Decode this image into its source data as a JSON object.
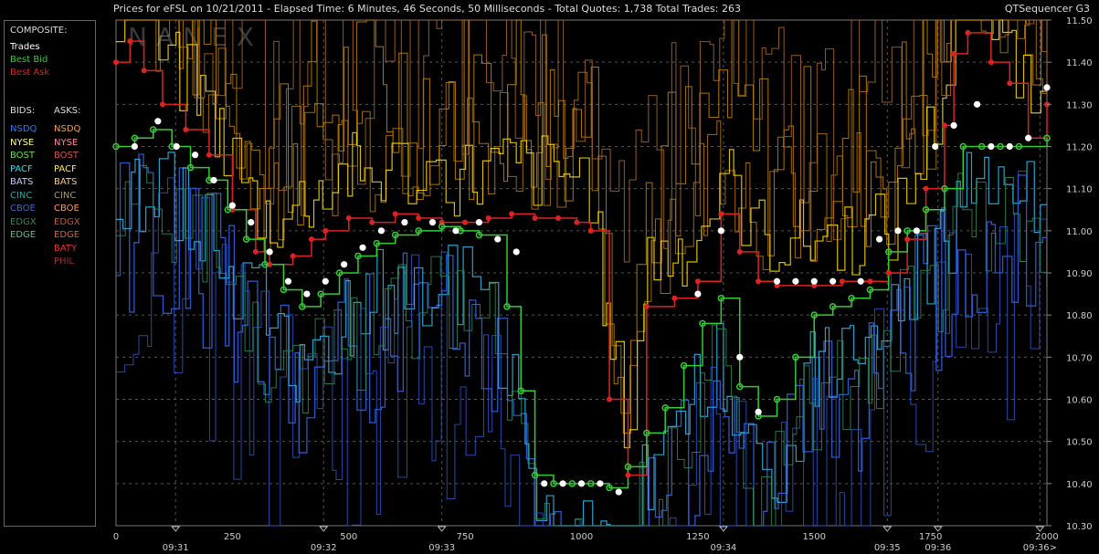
{
  "header": {
    "title": "Prices for  eFSL  on  10/21/2011  -  Elapsed Time: 6 Minutes, 46 Seconds, 50 Milliseconds  -  Total Quotes: 1,738  Total Trades: 263",
    "app_name": "QTSequencer G3"
  },
  "watermark": "NANEX",
  "legend": {
    "composite_label": "COMPOSITE:",
    "composite": [
      {
        "label": "Trades",
        "color": "#ffffff"
      },
      {
        "label": "Best Bid",
        "color": "#33cc33"
      },
      {
        "label": "Best Ask",
        "color": "#dd2222"
      }
    ],
    "bids_label": "BIDS:",
    "asks_label": "ASKS:",
    "bids": [
      {
        "label": "NSDQ",
        "color": "#3377ff"
      },
      {
        "label": "NYSE",
        "color": "#ffff88"
      },
      {
        "label": "BOST",
        "color": "#66dd55"
      },
      {
        "label": "PACF",
        "color": "#22ddee"
      },
      {
        "label": "BATS",
        "color": "#ccccff"
      },
      {
        "label": "CINC",
        "color": "#2aa6a6"
      },
      {
        "label": "CBOE",
        "color": "#4466cc"
      },
      {
        "label": "EDGX",
        "color": "#2e8b57"
      },
      {
        "label": "EDGE",
        "color": "#66bb88"
      }
    ],
    "asks": [
      {
        "label": "NSDQ",
        "color": "#ff9944"
      },
      {
        "label": "NYSE",
        "color": "#ff8899"
      },
      {
        "label": "BOST",
        "color": "#cc5555"
      },
      {
        "label": "PACF",
        "color": "#ffee44"
      },
      {
        "label": "BATS",
        "color": "#ffcc88"
      },
      {
        "label": "CINC",
        "color": "#aa9966"
      },
      {
        "label": "CBOE",
        "color": "#ff9955"
      },
      {
        "label": "EDGX",
        "color": "#cc5533"
      },
      {
        "label": "EDGE",
        "color": "#cc6633"
      },
      {
        "label": "BATY",
        "color": "#dd3333"
      },
      {
        "label": "PHIL",
        "color": "#993333"
      }
    ]
  },
  "colors": {
    "background": "#000000",
    "grid": "#555555",
    "trade": "#ffffff",
    "best_bid": "#33cc33",
    "best_ask": "#dd2222",
    "ask_yellow": "#ffdd00",
    "ask_orange": "#cc8800",
    "bid_blue": "#3366ee",
    "bid_cyan": "#33bbee"
  },
  "chart_data": {
    "type": "line",
    "x_axis": {
      "range": [
        0,
        2000
      ],
      "ticks": [
        0,
        250,
        500,
        750,
        1000,
        1250,
        1500,
        1750,
        2000
      ],
      "time_labels": [
        {
          "x": 128,
          "label": "09:31"
        },
        {
          "x": 446,
          "label": "09:32"
        },
        {
          "x": 700,
          "label": "09:33"
        },
        {
          "x": 1305,
          "label": "09:34"
        },
        {
          "x": 1657,
          "label": "09:35"
        },
        {
          "x": 1766,
          "label": "09:36"
        },
        {
          "x": 1985,
          "label": "09:36>"
        }
      ]
    },
    "y_axis": {
      "range": [
        10.3,
        11.5
      ],
      "ticks": [
        "10.30",
        "10.40",
        "10.50",
        "10.60",
        "10.70",
        "10.80",
        "10.90",
        "11.00",
        "11.10",
        "11.20",
        "11.30",
        "11.40",
        "11.50"
      ]
    },
    "grid": true,
    "series": [
      {
        "name": "Best Ask",
        "values": [
          [
            0,
            11.4
          ],
          [
            30,
            11.45
          ],
          [
            60,
            11.38
          ],
          [
            100,
            11.3
          ],
          [
            150,
            11.24
          ],
          [
            200,
            11.18
          ],
          [
            250,
            11.05
          ],
          [
            300,
            10.95
          ],
          [
            330,
            10.92
          ],
          [
            380,
            10.94
          ],
          [
            420,
            10.98
          ],
          [
            450,
            11.0
          ],
          [
            500,
            11.03
          ],
          [
            550,
            11.02
          ],
          [
            600,
            11.04
          ],
          [
            650,
            11.03
          ],
          [
            700,
            11.02
          ],
          [
            750,
            11.02
          ],
          [
            800,
            11.03
          ],
          [
            850,
            11.04
          ],
          [
            900,
            11.03
          ],
          [
            950,
            11.03
          ],
          [
            990,
            11.02
          ],
          [
            1020,
            11.0
          ],
          [
            1060,
            10.6
          ],
          [
            1100,
            10.42
          ],
          [
            1140,
            10.82
          ],
          [
            1200,
            10.84
          ],
          [
            1250,
            10.88
          ],
          [
            1300,
            11.04
          ],
          [
            1340,
            10.95
          ],
          [
            1380,
            10.88
          ],
          [
            1420,
            10.87
          ],
          [
            1500,
            10.87
          ],
          [
            1560,
            10.88
          ],
          [
            1620,
            10.88
          ],
          [
            1660,
            10.9
          ],
          [
            1700,
            10.98
          ],
          [
            1740,
            11.1
          ],
          [
            1780,
            11.25
          ],
          [
            1800,
            11.42
          ],
          [
            1830,
            11.47
          ],
          [
            1880,
            11.4
          ],
          [
            1920,
            11.35
          ],
          [
            1960,
            11.22
          ],
          [
            2000,
            11.3
          ]
        ]
      },
      {
        "name": "Best Bid",
        "values": [
          [
            0,
            11.2
          ],
          [
            40,
            11.22
          ],
          [
            80,
            11.24
          ],
          [
            120,
            11.2
          ],
          [
            160,
            11.15
          ],
          [
            200,
            11.12
          ],
          [
            240,
            11.05
          ],
          [
            280,
            10.98
          ],
          [
            320,
            10.92
          ],
          [
            360,
            10.86
          ],
          [
            400,
            10.82
          ],
          [
            440,
            10.85
          ],
          [
            480,
            10.9
          ],
          [
            520,
            10.94
          ],
          [
            560,
            10.97
          ],
          [
            600,
            10.99
          ],
          [
            650,
            11.0
          ],
          [
            700,
            11.01
          ],
          [
            740,
            11.0
          ],
          [
            780,
            10.99
          ],
          [
            840,
            10.82
          ],
          [
            870,
            10.62
          ],
          [
            900,
            10.42
          ],
          [
            940,
            10.4
          ],
          [
            980,
            10.4
          ],
          [
            1020,
            10.4
          ],
          [
            1060,
            10.39
          ],
          [
            1100,
            10.44
          ],
          [
            1140,
            10.52
          ],
          [
            1180,
            10.58
          ],
          [
            1220,
            10.68
          ],
          [
            1260,
            10.78
          ],
          [
            1300,
            10.84
          ],
          [
            1340,
            10.63
          ],
          [
            1380,
            10.56
          ],
          [
            1420,
            10.6
          ],
          [
            1460,
            10.7
          ],
          [
            1500,
            10.8
          ],
          [
            1540,
            10.82
          ],
          [
            1580,
            10.84
          ],
          [
            1620,
            10.86
          ],
          [
            1660,
            10.95
          ],
          [
            1700,
            11.0
          ],
          [
            1740,
            11.05
          ],
          [
            1780,
            11.1
          ],
          [
            1820,
            11.2
          ],
          [
            1860,
            11.2
          ],
          [
            1900,
            11.2
          ],
          [
            1940,
            11.2
          ],
          [
            2000,
            11.22
          ]
        ]
      },
      {
        "name": "Trades",
        "values": [
          [
            40,
            11.2
          ],
          [
            90,
            11.26
          ],
          [
            130,
            11.2
          ],
          [
            170,
            11.18
          ],
          [
            210,
            11.12
          ],
          [
            250,
            11.06
          ],
          [
            290,
            11.02
          ],
          [
            330,
            10.95
          ],
          [
            370,
            10.88
          ],
          [
            410,
            10.85
          ],
          [
            450,
            10.88
          ],
          [
            490,
            10.92
          ],
          [
            530,
            10.96
          ],
          [
            570,
            11.0
          ],
          [
            620,
            11.02
          ],
          [
            680,
            11.02
          ],
          [
            730,
            11.0
          ],
          [
            780,
            11.02
          ],
          [
            820,
            10.98
          ],
          [
            860,
            10.95
          ],
          [
            920,
            10.4
          ],
          [
            960,
            10.4
          ],
          [
            1000,
            10.4
          ],
          [
            1040,
            10.4
          ],
          [
            1080,
            10.38
          ],
          [
            1250,
            10.85
          ],
          [
            1300,
            11.0
          ],
          [
            1340,
            10.7
          ],
          [
            1380,
            10.57
          ],
          [
            1420,
            10.88
          ],
          [
            1460,
            10.88
          ],
          [
            1500,
            10.88
          ],
          [
            1540,
            10.88
          ],
          [
            1600,
            10.88
          ],
          [
            1640,
            10.98
          ],
          [
            1680,
            11.0
          ],
          [
            1720,
            11.0
          ],
          [
            1760,
            11.2
          ],
          [
            1800,
            11.25
          ],
          [
            1850,
            11.3
          ],
          [
            1880,
            11.2
          ],
          [
            1920,
            11.2
          ],
          [
            1960,
            11.22
          ],
          [
            2000,
            11.34
          ]
        ]
      }
    ]
  }
}
